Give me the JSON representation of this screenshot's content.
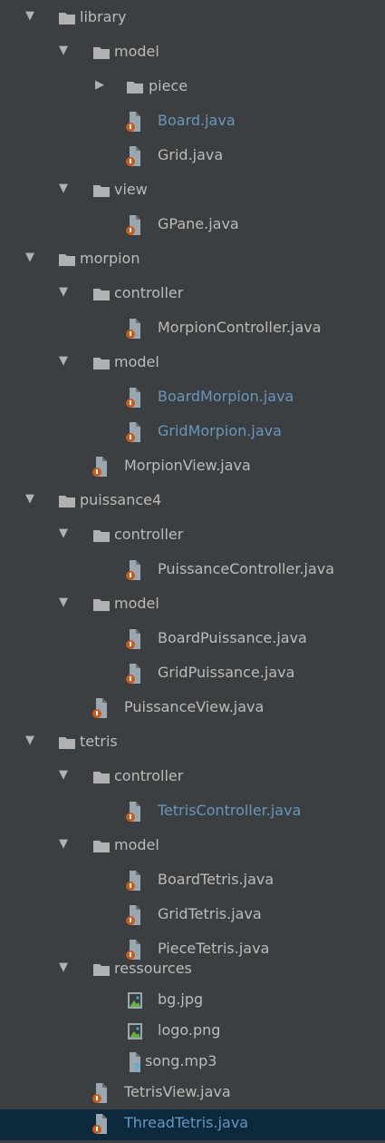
{
  "colors": {
    "background": "#3c3f41",
    "text": "#bbbbbb",
    "modified_text": "#6897bb",
    "selected_row": "#0d293e",
    "folder": "#afb1b3",
    "java_badge": "#c75a1c"
  },
  "tree": {
    "nodes": [
      {
        "label": "library",
        "type": "folder",
        "expanded": true
      },
      {
        "label": "model",
        "type": "folder",
        "expanded": true
      },
      {
        "label": "piece",
        "type": "folder",
        "expanded": false
      },
      {
        "label": "Board.java",
        "type": "java-file",
        "status": "modified"
      },
      {
        "label": "Grid.java",
        "type": "java-file"
      },
      {
        "label": "view",
        "type": "folder",
        "expanded": true
      },
      {
        "label": "GPane.java",
        "type": "java-file"
      },
      {
        "label": "morpion",
        "type": "folder",
        "expanded": true
      },
      {
        "label": "controller",
        "type": "folder",
        "expanded": true
      },
      {
        "label": "MorpionController.java",
        "type": "java-file"
      },
      {
        "label": "model",
        "type": "folder",
        "expanded": true
      },
      {
        "label": "BoardMorpion.java",
        "type": "java-file",
        "status": "modified"
      },
      {
        "label": "GridMorpion.java",
        "type": "java-file",
        "status": "modified"
      },
      {
        "label": "MorpionView.java",
        "type": "java-file"
      },
      {
        "label": "puissance4",
        "type": "folder",
        "expanded": true
      },
      {
        "label": "controller",
        "type": "folder",
        "expanded": true
      },
      {
        "label": "PuissanceController.java",
        "type": "java-file"
      },
      {
        "label": "model",
        "type": "folder",
        "expanded": true
      },
      {
        "label": "BoardPuissance.java",
        "type": "java-file"
      },
      {
        "label": "GridPuissance.java",
        "type": "java-file"
      },
      {
        "label": "PuissanceView.java",
        "type": "java-file"
      },
      {
        "label": "tetris",
        "type": "folder",
        "expanded": true
      },
      {
        "label": "controller",
        "type": "folder",
        "expanded": true
      },
      {
        "label": "TetrisController.java",
        "type": "java-file",
        "status": "modified"
      },
      {
        "label": "model",
        "type": "folder",
        "expanded": true
      },
      {
        "label": "BoardTetris.java",
        "type": "java-file"
      },
      {
        "label": "GridTetris.java",
        "type": "java-file"
      },
      {
        "label": "PieceTetris.java",
        "type": "java-file"
      },
      {
        "label": "ressources",
        "type": "folder",
        "expanded": true
      },
      {
        "label": "bg.jpg",
        "type": "image-file"
      },
      {
        "label": "logo.png",
        "type": "image-file"
      },
      {
        "label": "song.mp3",
        "type": "unknown-file"
      },
      {
        "label": "TetrisView.java",
        "type": "java-file"
      },
      {
        "label": "ThreadTetris.java",
        "type": "java-file",
        "status": "modified",
        "selected": true
      }
    ]
  }
}
